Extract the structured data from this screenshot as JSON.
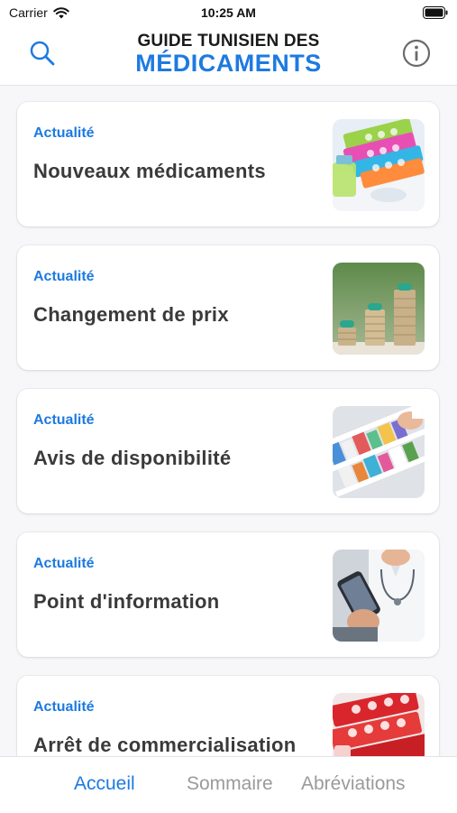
{
  "status_bar": {
    "carrier": "Carrier",
    "time": "10:25 AM"
  },
  "header": {
    "brand_line1": "GUIDE TUNISIEN DES",
    "brand_line2": "MÉDICAMENTS",
    "left_icon": "search-icon",
    "right_icon": "info-icon"
  },
  "cards": [
    {
      "category": "Actualité",
      "title": "Nouveaux médicaments",
      "image": "colorful-pill-blisters"
    },
    {
      "category": "Actualité",
      "title": "Changement de prix",
      "image": "coin-stacks-with-pills"
    },
    {
      "category": "Actualité",
      "title": "Avis de disponibilité",
      "image": "pharmacy-shelves"
    },
    {
      "category": "Actualité",
      "title": "Point d'information",
      "image": "doctor-with-phone"
    },
    {
      "category": "Actualité",
      "title": "Arrêt de commercialisation",
      "image": "red-pill-blisters"
    }
  ],
  "tabs": [
    {
      "label": "Accueil",
      "active": true
    },
    {
      "label": "Sommaire",
      "active": false
    },
    {
      "label": "Abréviations",
      "active": false
    }
  ],
  "colors": {
    "accent": "#1d7ae0",
    "title_text": "#3a3a3a",
    "inactive_tab": "#9a9a9e"
  }
}
